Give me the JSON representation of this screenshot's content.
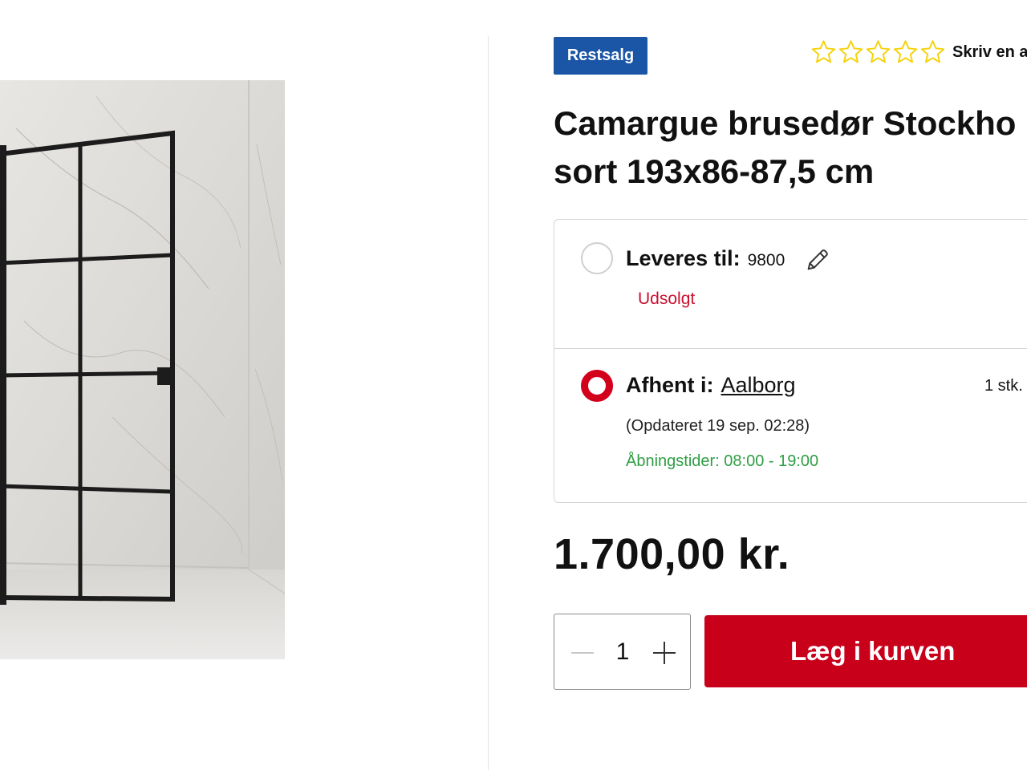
{
  "badge": {
    "label": "Restsalg"
  },
  "rating": {
    "stars": 5,
    "filled": 0,
    "review_link": "Skriv en a"
  },
  "product": {
    "title_line1": "Camargue brusedør Stockho",
    "title_line2": "sort 193x86-87,5 cm",
    "image_icon": "product-photo"
  },
  "delivery": {
    "home": {
      "label": "Leveres til:",
      "postal_code": "9800",
      "status": "Udsolgt",
      "icon": "pencil-icon"
    },
    "store": {
      "label": "Afhent i:",
      "store_name": "Aalborg",
      "stock": "1 stk.",
      "updated": "(Opdateret 19 sep. 02:28)",
      "hours": "Åbningstider: 08:00 - 19:00"
    }
  },
  "price": {
    "value": "1.700,00 kr."
  },
  "cart": {
    "quantity": "1",
    "add_label": "Læg i kurven"
  },
  "colors": {
    "badge": "#1b55a5",
    "accent_red": "#c8001a",
    "sold_out": "#c8102e",
    "hours_green": "#2f9e44",
    "star_yellow": "#f5d20a"
  }
}
